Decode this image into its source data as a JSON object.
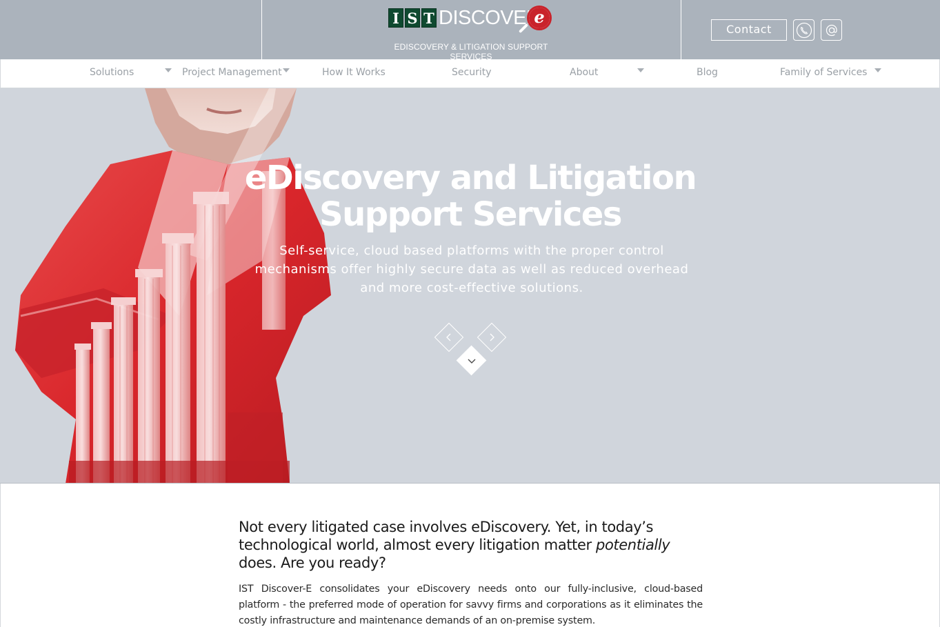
{
  "header": {
    "logo": {
      "letters": [
        "I",
        "S",
        "T"
      ],
      "word": "DISCOVER",
      "badge": "e"
    },
    "tagline": "EDISCOVERY & LITIGATION SUPPORT SERVICES",
    "contact_label": "Contact",
    "icons": [
      "phone-icon",
      "email-icon"
    ]
  },
  "nav": {
    "items": [
      {
        "label": "Solutions",
        "has_dropdown": true
      },
      {
        "label": "Project Management",
        "has_dropdown": true
      },
      {
        "label": "How It Works",
        "has_dropdown": false
      },
      {
        "label": "Security",
        "has_dropdown": false
      },
      {
        "label": "About",
        "has_dropdown": true
      },
      {
        "label": "Blog",
        "has_dropdown": false
      },
      {
        "label": "Family of Services",
        "has_dropdown": true
      }
    ]
  },
  "hero": {
    "title_line1": "eDiscovery and Litigation",
    "title_line2": "Support Services",
    "subtitle": "Self-service, cloud based platforms with the proper control mechanisms offer highly secure data as well as reduced overhead and more cost-effective solutions."
  },
  "content": {
    "lead_part1": "Not every litigated case involves eDiscovery.  Yet, in today’s technological world, almost every litigation matter ",
    "lead_emphasis": "potentially",
    "lead_part2": " does.  Are you ready?",
    "body": "IST Discover-E consolidates your eDiscovery needs onto our fully-inclusive, cloud-based platform - the preferred mode of operation for savvy firms and corporations as it eliminates the costly infrastructure and maintenance demands of an on-premise system."
  },
  "colors": {
    "header_bg": "#abb3bc",
    "hero_bg": "#d0d5dc",
    "brand_green": "#0f4a30",
    "brand_red": "#c9232b",
    "nav_text": "#9aa0a6"
  }
}
